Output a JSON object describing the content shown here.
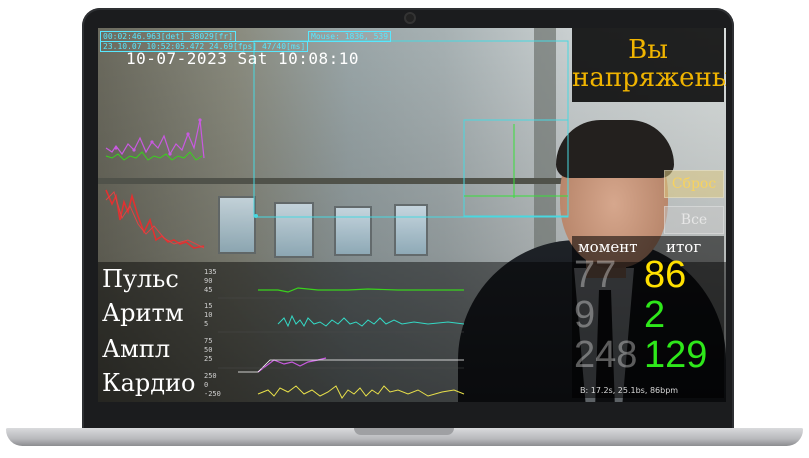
{
  "overlay": {
    "debug_line_1": "00:02:46.963[det] 38029[fr]",
    "debug_line_2": "23.10.07 10:52:05.472 24.69[fps] 47/40[ms]",
    "mouse_readout": "Mouse: 1836, 539",
    "datetime": "10-07-2023 Sat 10:08:10"
  },
  "status": {
    "line_1": "Вы",
    "line_2": "напряжены",
    "color": "#f0b400"
  },
  "buttons": {
    "reset_label": "Сброс",
    "all_label": "Все"
  },
  "results": {
    "header_moment": "момент",
    "header_total": "итог",
    "rows": [
      {
        "moment": "77",
        "total": "86",
        "total_color": "#ffe000"
      },
      {
        "moment": "9",
        "total": "2",
        "total_color": "#2ee81a"
      },
      {
        "moment": "248",
        "total": "129",
        "total_color": "#2ee81a"
      }
    ],
    "footer": "В: 17.2s, 25.1bs, 86bpm"
  },
  "metrics": {
    "labels": [
      "Пульс",
      "Аритм",
      "Ампл",
      "Кардио"
    ],
    "scales": {
      "pulse": [
        "135",
        "90",
        "45"
      ],
      "arrhythmia": [
        "15",
        "10",
        "5"
      ],
      "amplitude": [
        "75",
        "50",
        "25"
      ],
      "cardio": [
        "250",
        "0",
        "-250"
      ]
    },
    "colors": {
      "pulse": "#39d31c",
      "arrhythmia": "#34d9c5",
      "amplitude": "#c85ae0",
      "cardio": "#e8e04a"
    }
  }
}
